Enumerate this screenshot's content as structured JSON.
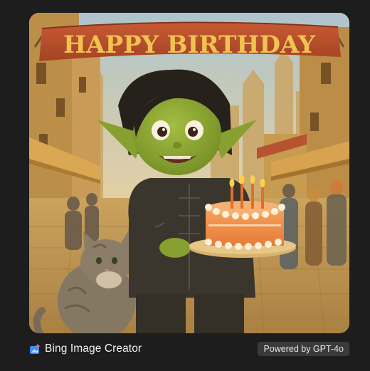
{
  "image": {
    "banner_text": "HAPPY BIRTHDAY"
  },
  "footer": {
    "brand_label": "Bing Image Creator",
    "badge_label": "Powered by GPT-4o"
  },
  "colors": {
    "background": "#1d1d1d",
    "badge_bg": "#3a3a3a",
    "brand_icon_blue": "#3b8cff",
    "brand_icon_pink": "#ff5fa0"
  },
  "icons": {
    "brand": "bing-image-creator-icon"
  }
}
